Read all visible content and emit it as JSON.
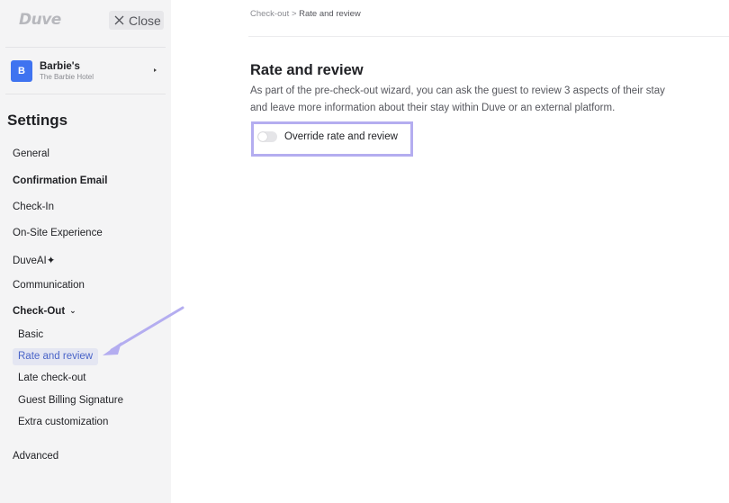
{
  "sidebar": {
    "logo": "Duve",
    "close_label": "Close",
    "hotel": {
      "avatar_letter": "B",
      "name": "Barbie's",
      "subtitle": "The Barbie Hotel"
    },
    "settings_title": "Settings",
    "nav": {
      "general": "General",
      "confirmation_email": "Confirmation Email",
      "check_in": "Check-In",
      "on_site": "On-Site Experience",
      "duveai": "DuveAI",
      "duveai_icon": "✦",
      "communication": "Communication",
      "check_out": "Check-Out",
      "check_out_chevron": "⌄",
      "advanced": "Advanced"
    },
    "checkout_items": {
      "basic": "Basic",
      "rate_review": "Rate and review",
      "late_checkout": "Late check-out",
      "guest_billing": "Guest Billing Signature",
      "extra_customization": "Extra customization"
    }
  },
  "main": {
    "breadcrumb": {
      "parent": "Check-out",
      "separator": " > ",
      "current": "Rate and review"
    },
    "title": "Rate and review",
    "description": "As part of the pre-check-out wizard, you can ask the guest to review 3 aspects of their stay and leave more information about their stay within Duve or an external platform.",
    "toggle": {
      "label": "Override rate and review",
      "checked": false
    }
  },
  "colors": {
    "accent": "#4a64c8",
    "highlight": "#b4adf0",
    "avatar": "#3f73f0",
    "sidebar_bg": "#f4f4f5"
  }
}
